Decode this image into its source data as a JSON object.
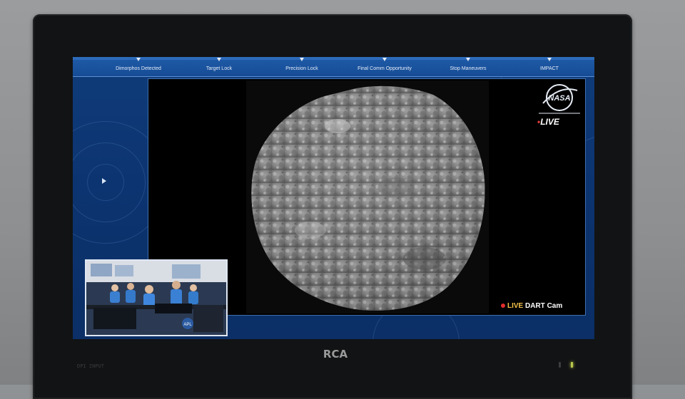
{
  "tv": {
    "brand": "RCA",
    "mode_label": "DPI INPUT"
  },
  "broadcast": {
    "progress_stages": [
      {
        "label": "Dimorphos Detected"
      },
      {
        "label": "Target Lock"
      },
      {
        "label": "Precision Lock"
      },
      {
        "label": "Final Comm Opportunity"
      },
      {
        "label": "Stop Maneuvers"
      },
      {
        "label": "IMPACT"
      }
    ],
    "logo_text": "NASA",
    "live_badge": "LIVE",
    "camera_feed": {
      "live_word": "LIVE",
      "name": "DART Cam"
    },
    "inset_logo": "APL"
  },
  "colors": {
    "broadcast_blue": "#0c3470",
    "live_red": "#e02d2d",
    "live_yellow": "#f3c04a"
  },
  "icons": [
    "nasa-logo-icon",
    "red-dot-icon",
    "play-marker-icon",
    "power-led-icon"
  ]
}
